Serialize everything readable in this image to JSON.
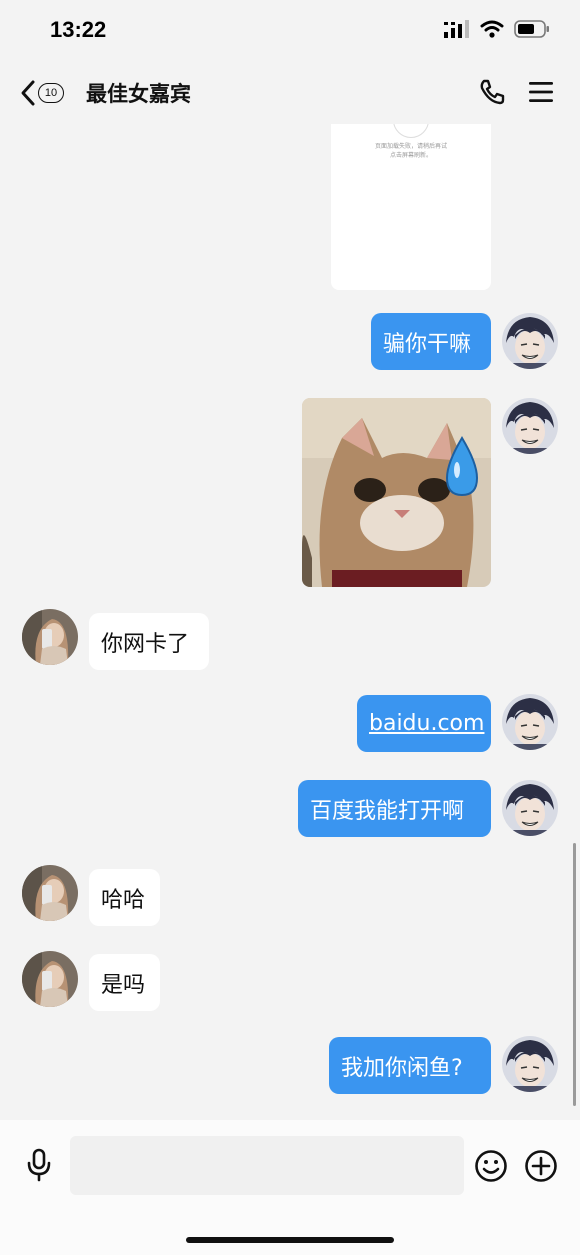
{
  "status_bar": {
    "time": "13:22"
  },
  "header": {
    "unread_count": "10",
    "title": "最佳女嘉宾"
  },
  "preview_card": {
    "lines": [
      "页面加载失败，请稍后再试",
      "点击屏幕刷新。"
    ]
  },
  "messages": [
    {
      "from": "me",
      "type": "text",
      "text": "骗你干嘛"
    },
    {
      "from": "me",
      "type": "image",
      "icon": "sweat-drop-icon"
    },
    {
      "from": "peer",
      "type": "text",
      "text": "你网卡了"
    },
    {
      "from": "me",
      "type": "link",
      "text": "baidu.com"
    },
    {
      "from": "me",
      "type": "text",
      "text": "百度我能打开啊"
    },
    {
      "from": "peer",
      "type": "text",
      "text": "哈哈"
    },
    {
      "from": "peer",
      "type": "text",
      "text": "是吗"
    },
    {
      "from": "me",
      "type": "text",
      "text": "我加你闲鱼?"
    }
  ],
  "colors": {
    "outgoing_bubble": "#3a95f0",
    "incoming_bubble": "#ffffff",
    "background": "#f3f3f3"
  }
}
